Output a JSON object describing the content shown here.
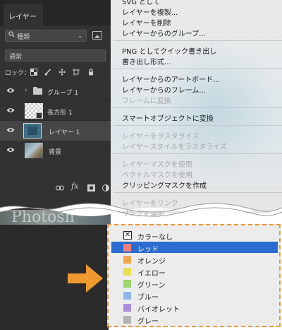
{
  "panel": {
    "tab_label": "レイヤー",
    "filter_kind": "種類",
    "blend_mode": "通常",
    "lock_label": "ロック：",
    "layers": [
      {
        "name": "グループ 1",
        "type": "group",
        "visible": true,
        "selected": false
      },
      {
        "name": "長方形 1",
        "type": "shape",
        "visible": true,
        "selected": false
      },
      {
        "name": "レイヤー 1",
        "type": "pixel",
        "visible": true,
        "selected": true
      },
      {
        "name": "背景",
        "type": "background",
        "visible": true,
        "selected": false
      }
    ],
    "footer_icons": [
      "link-icon",
      "fx-icon",
      "mask-icon",
      "new-adjustment-icon"
    ],
    "footer_fx": "fx"
  },
  "menu": {
    "items": [
      {
        "label": "SVG として",
        "disabled": false
      },
      {
        "label": "レイヤーを複製...",
        "disabled": false
      },
      {
        "label": "レイヤーを削除",
        "disabled": false
      },
      {
        "label": "レイヤーからのグループ...",
        "disabled": false
      },
      {
        "label": "PNG としてクイック書き出し",
        "disabled": false
      },
      {
        "label": "書き出し形式...",
        "disabled": false
      },
      {
        "label": "レイヤーからのアートボード...",
        "disabled": false
      },
      {
        "label": "レイヤーからのフレーム...",
        "disabled": false
      },
      {
        "label": "フレームに変換",
        "disabled": true
      },
      {
        "label": "スマートオブジェクトに変換",
        "disabled": false
      },
      {
        "label": "レイヤーをラスタライズ",
        "disabled": true
      },
      {
        "label": "レイヤースタイルをラスタライズ",
        "disabled": true
      },
      {
        "label": "レイヤーマスクを使用",
        "disabled": true
      },
      {
        "label": "ベクトルマスクを使用",
        "disabled": true
      },
      {
        "label": "クリッピングマスクを作成",
        "disabled": false
      },
      {
        "label": "レイヤーをリンク",
        "disabled": true
      },
      {
        "label": "リンクを選択",
        "disabled": true
      }
    ]
  },
  "background_text": "Photosh",
  "swatches": [
    {
      "label": "カラーなし",
      "color": null,
      "selected": false
    },
    {
      "label": "レッド",
      "color": "#f07f7f",
      "selected": true
    },
    {
      "label": "オレンジ",
      "color": "#f2a44b",
      "selected": false
    },
    {
      "label": "イエロー",
      "color": "#e9e04f",
      "selected": false
    },
    {
      "label": "グリーン",
      "color": "#9fd66e",
      "selected": false
    },
    {
      "label": "ブルー",
      "color": "#8fb8ee",
      "selected": false
    },
    {
      "label": "バイオレット",
      "color": "#a88ee0",
      "selected": false
    },
    {
      "label": "グレー",
      "color": "#b4b4b4",
      "selected": false
    }
  ],
  "colors": {
    "panel_bg": "#323232",
    "highlight": "#2a6cd0",
    "callout_arrow": "#ef9a2e",
    "dashed_border": "#e99a3a"
  }
}
